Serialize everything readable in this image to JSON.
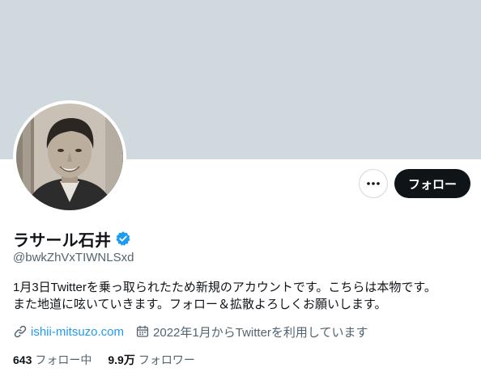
{
  "profile": {
    "display_name": "ラサール石井",
    "handle": "@bwkZhVxTIWNLSxd",
    "verified": true,
    "bio_lines": [
      "1月3日Twitterを乗っ取られたため新規のアカウントです。こちらは本物です。",
      "また地道に呟いていきます。フォロー＆拡散よろしくお願いします。"
    ],
    "website": "ishii-mitsuzo.com",
    "joined": "2022年1月からTwitterを利用しています"
  },
  "actions": {
    "follow_label": "フォロー"
  },
  "stats": {
    "following_count": "643",
    "following_label": "フォロー中",
    "followers_count": "9.9万",
    "followers_label": "フォロワー"
  },
  "icons": {
    "more": "more-horizontal-icon",
    "verified": "verified-badge-icon",
    "link": "link-icon",
    "calendar": "calendar-icon"
  },
  "colors": {
    "banner": "#cfd9de",
    "accent": "#1d9bf0",
    "text_primary": "#0f1419",
    "text_secondary": "#536471",
    "follow_button_bg": "#0f1419"
  }
}
